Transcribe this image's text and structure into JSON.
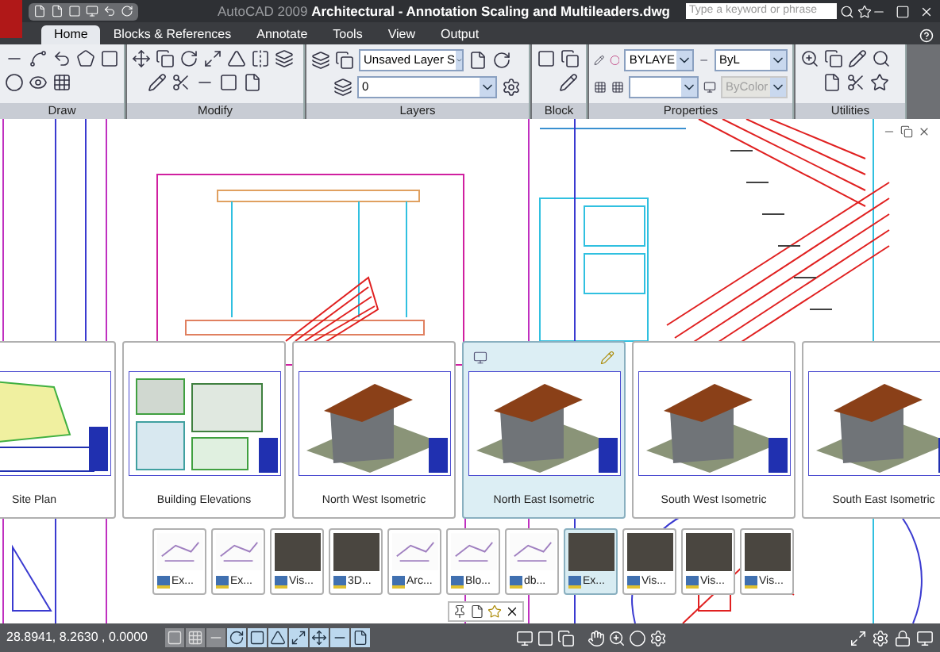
{
  "window": {
    "title": "AutoCAD 2009 **Architectural - Annotation Scaling and Multileaders.dwg**",
    "search": {
      "placeholder": "Type a keyword or phrase"
    }
  },
  "tabs": [
    {
      "label": "Home",
      "selected": true
    },
    {
      "label": "Blocks & References",
      "selected": false
    },
    {
      "label": "Annotate",
      "selected": false
    },
    {
      "label": "Tools",
      "selected": false
    },
    {
      "label": "View",
      "selected": false
    },
    {
      "label": "Output",
      "selected": false
    }
  ],
  "ribbon": {
    "panels": [
      {
        "kind": "draw",
        "title": "Draw"
      },
      {
        "kind": "modify",
        "title": "Modify"
      },
      {
        "kind": "layers",
        "title": "Layers",
        "layer_state": "Unsaved Layer S",
        "layer": "0"
      },
      {
        "kind": "block",
        "title": "Block"
      },
      {
        "kind": "properties",
        "title": "Properties",
        "color_setting": "BYLAYE",
        "lineweight": "ByL",
        "plot_style": {
          "value": "ByColor",
          "disabled": true
        }
      },
      {
        "kind": "utilities",
        "title": "Utilities"
      }
    ]
  },
  "layout_previews": [
    {
      "label": "Site Plan",
      "kind": "plan",
      "selected": false
    },
    {
      "label": "Building Elevations",
      "kind": "elevations",
      "selected": false
    },
    {
      "label": "North West Isometric",
      "kind": "render",
      "selected": false
    },
    {
      "label": "North East Isometric",
      "kind": "render",
      "selected": true
    },
    {
      "label": "South West Isometric",
      "kind": "render",
      "selected": false
    },
    {
      "label": "South East Isometric",
      "kind": "render",
      "selected": false
    }
  ],
  "view_previews": [
    {
      "label": "Ex...",
      "kind": "sketch",
      "selected": false
    },
    {
      "label": "Ex...",
      "kind": "sketch",
      "selected": false
    },
    {
      "label": "Vis...",
      "kind": "photo",
      "selected": false
    },
    {
      "label": "3D...",
      "kind": "photo",
      "selected": false
    },
    {
      "label": "Arc...",
      "kind": "sketch",
      "selected": false
    },
    {
      "label": "Blo...",
      "kind": "sketch",
      "selected": false
    },
    {
      "label": "db...",
      "kind": "sketch",
      "selected": false
    },
    {
      "label": "Ex...",
      "kind": "photo",
      "selected": true
    },
    {
      "label": "Vis...",
      "kind": "photo",
      "selected": false
    },
    {
      "label": "Vis...",
      "kind": "photo",
      "selected": false
    },
    {
      "label": "Vis...",
      "kind": "photo",
      "selected": false
    }
  ],
  "status_bar": {
    "coordinates": "28.8941, 8.2630 , 0.0000",
    "toggles": [
      {
        "on": false
      },
      {
        "on": false
      },
      {
        "on": false
      },
      {
        "on": true
      },
      {
        "on": true
      },
      {
        "on": true
      },
      {
        "on": true
      },
      {
        "on": true
      },
      {
        "on": true
      },
      {
        "on": true
      }
    ]
  }
}
